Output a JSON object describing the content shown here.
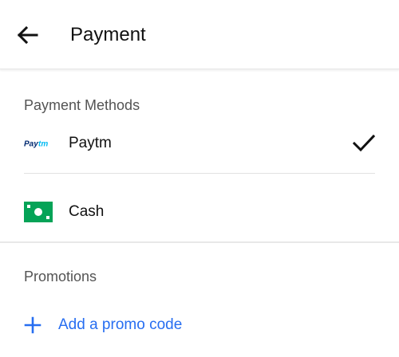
{
  "header": {
    "title": "Payment",
    "back_icon": "arrow-left-icon"
  },
  "payment_methods": {
    "heading": "Payment Methods",
    "items": [
      {
        "label": "Paytm",
        "logo_text": "Paytm",
        "icon": "paytm-logo-icon",
        "selected": true
      },
      {
        "label": "Cash",
        "icon": "cash-icon",
        "selected": false
      }
    ]
  },
  "promotions": {
    "heading": "Promotions",
    "add_label": "Add a promo code",
    "add_icon": "plus-icon"
  },
  "colors": {
    "accent_blue": "#276ef1",
    "cash_green": "#05a357",
    "paytm_navy": "#002970",
    "paytm_cyan": "#00baf2"
  }
}
